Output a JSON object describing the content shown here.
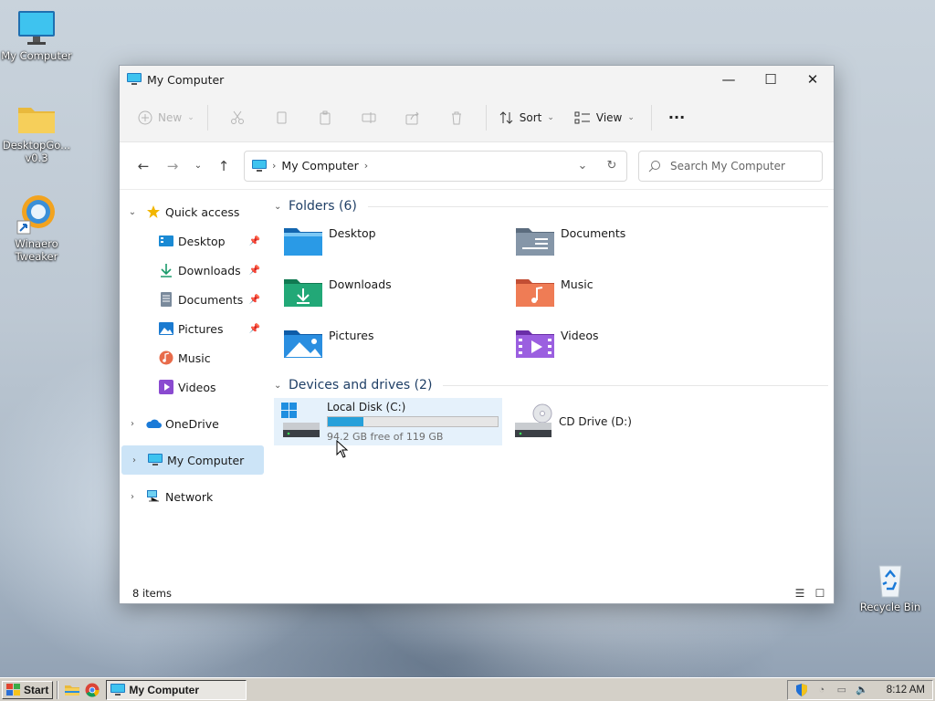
{
  "desktop": {
    "icons": [
      {
        "label": "My Computer",
        "icon": "monitor-icon"
      },
      {
        "label": "DesktopGo...",
        "label2": "v0.3",
        "icon": "folder-icon"
      },
      {
        "label": "Winaero",
        "label2": "Tweaker",
        "icon": "winaero-tweaker-icon"
      },
      {
        "label": "Recycle Bin",
        "icon": "recycle-bin-icon"
      }
    ]
  },
  "window": {
    "title": "My Computer",
    "caption": {
      "minimize": "—",
      "maximize": "☐",
      "close": "✕"
    },
    "toolbar": {
      "new_label": "New",
      "sort_label": "Sort",
      "view_label": "View",
      "more_label": "···"
    },
    "address": {
      "crumb": "My Computer",
      "search_placeholder": "Search My Computer"
    },
    "nav": {
      "quick_access": "Quick access",
      "pinned": [
        {
          "label": "Desktop",
          "pinned": true
        },
        {
          "label": "Downloads",
          "pinned": true
        },
        {
          "label": "Documents",
          "pinned": true
        },
        {
          "label": "Pictures",
          "pinned": true
        },
        {
          "label": "Music",
          "pinned": false
        },
        {
          "label": "Videos",
          "pinned": false
        }
      ],
      "onedrive": "OneDrive",
      "my_computer": "My Computer",
      "network": "Network"
    },
    "folders_header": "Folders (6)",
    "folders": [
      {
        "label": "Desktop",
        "color": "#1a8ad4"
      },
      {
        "label": "Documents",
        "color": "#7a8a9c"
      },
      {
        "label": "Downloads",
        "color": "#1a9a6a"
      },
      {
        "label": "Music",
        "color": "#e86b4a"
      },
      {
        "label": "Pictures",
        "color": "#1a7ad0"
      },
      {
        "label": "Videos",
        "color": "#8a4ad0"
      }
    ],
    "drives_header": "Devices and drives (2)",
    "drives": {
      "c": {
        "name": "Local Disk (C:)",
        "free": "94.2 GB free of 119 GB",
        "used_fraction": 0.21
      },
      "d": {
        "name": "CD Drive (D:)"
      }
    },
    "status": "8 items"
  },
  "taskbar": {
    "start_label": "Start",
    "task_label": "My Computer",
    "clock": "8:12 AM"
  }
}
